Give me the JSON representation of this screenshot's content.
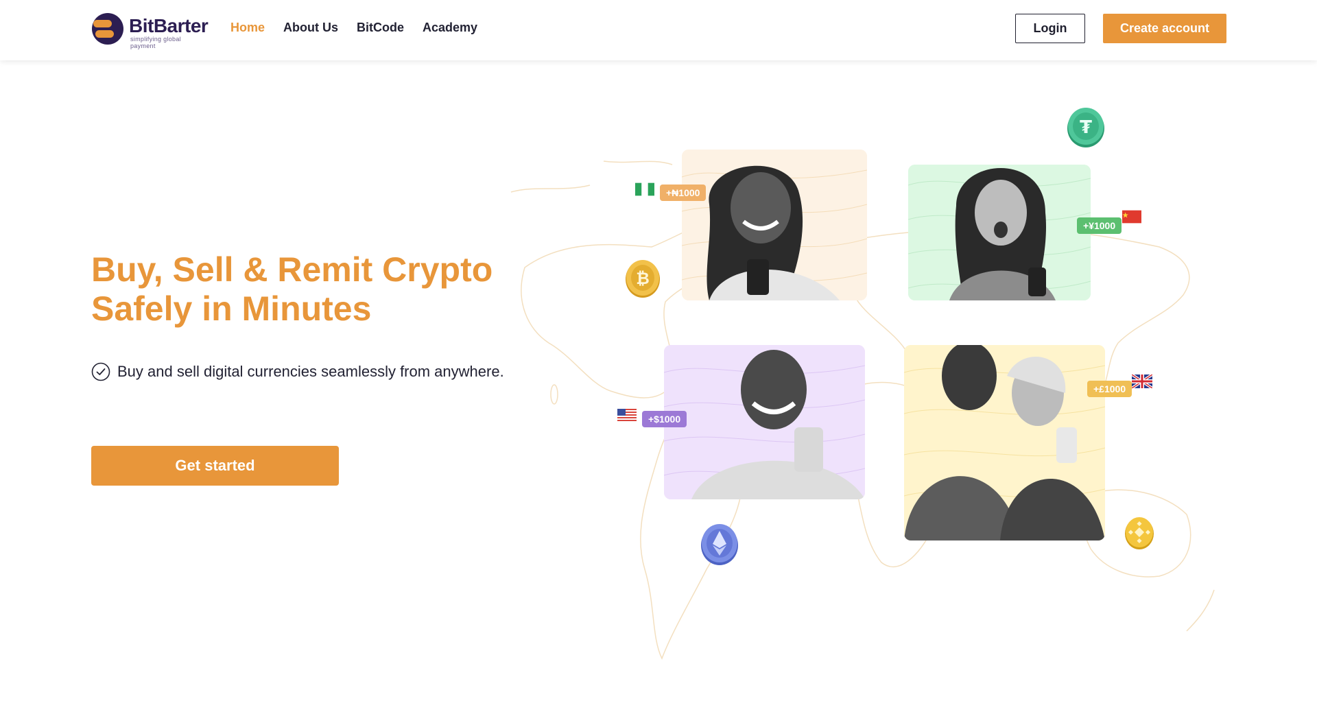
{
  "brand": {
    "name": "BitBarter",
    "tagline": "simplifying global payment",
    "accent_color": "#e8963a",
    "dark_color": "#2c1e52"
  },
  "nav": {
    "items": [
      {
        "label": "Home",
        "active": true
      },
      {
        "label": "About Us",
        "active": false
      },
      {
        "label": "BitCode",
        "active": false
      },
      {
        "label": "Academy",
        "active": false
      }
    ]
  },
  "auth": {
    "login_label": "Login",
    "create_label": "Create account"
  },
  "hero": {
    "title": "Buy, Sell & Remit Crypto Safely in Minutes",
    "feature_text": "Buy and sell digital currencies seamlessly from anywhere.",
    "cta_label": "Get started"
  },
  "art": {
    "pills": [
      {
        "text": "+₦1000",
        "color": "#f0b068"
      },
      {
        "text": "+¥1000",
        "color": "#5cbf70"
      },
      {
        "text": "+$1000",
        "color": "#9c79d6"
      },
      {
        "text": "+£1000",
        "color": "#f0bf55"
      }
    ],
    "coins": [
      "bitcoin-coin-icon",
      "tether-coin-icon",
      "ethereum-coin-icon",
      "binance-coin-icon"
    ],
    "flags": [
      "nigeria-flag-icon",
      "china-flag-icon",
      "usa-flag-icon",
      "uk-flag-icon"
    ]
  }
}
